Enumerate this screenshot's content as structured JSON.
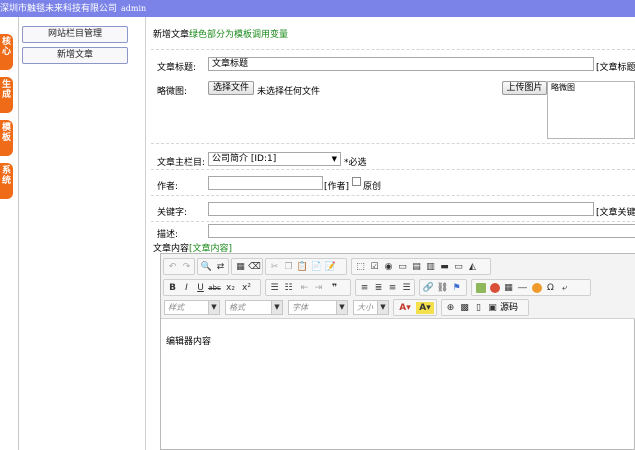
{
  "topbar": {
    "company": "深圳市触毯未来科技有限公司",
    "user": "admin"
  },
  "sidetabs": [
    {
      "label": "核心"
    },
    {
      "label": "生成"
    },
    {
      "label": "模板"
    },
    {
      "label": "系统"
    }
  ],
  "leftmenu": [
    {
      "label": "网站栏目管理"
    },
    {
      "label": "新增文章"
    }
  ],
  "header": {
    "title": "新增文章",
    "hint": "绿色部分为模板调用变量"
  },
  "form": {
    "title_label": "文章标题:",
    "title_value": "文章标题",
    "title_var": "[文章标题]",
    "thumb_label": "略微图:",
    "choose_file": "选择文件",
    "no_file": "未选择任何文件",
    "upload": "上传图片",
    "thumb_preview": "略微图",
    "column_label": "文章主栏目:",
    "column_value": "公司简介 [ID:1]",
    "required": "*必选",
    "author_label": "作者:",
    "author_var": "[作者]",
    "original_label": "原创",
    "keywords_label": "关键字:",
    "keywords_var": "[文章关键字",
    "desc_label": "描述:",
    "content_label": "文章内容",
    "content_var": "[文章内容]"
  },
  "editor": {
    "combos": [
      {
        "label": "样式"
      },
      {
        "label": "格式"
      },
      {
        "label": "字体"
      },
      {
        "label": "大小"
      }
    ],
    "source_label": "源码",
    "body_text": "编辑器内容"
  },
  "colors": {
    "topbar": "#7b83e8",
    "tab": "#ef6b18",
    "green": "#1a8a1a",
    "required": "#e00000"
  }
}
